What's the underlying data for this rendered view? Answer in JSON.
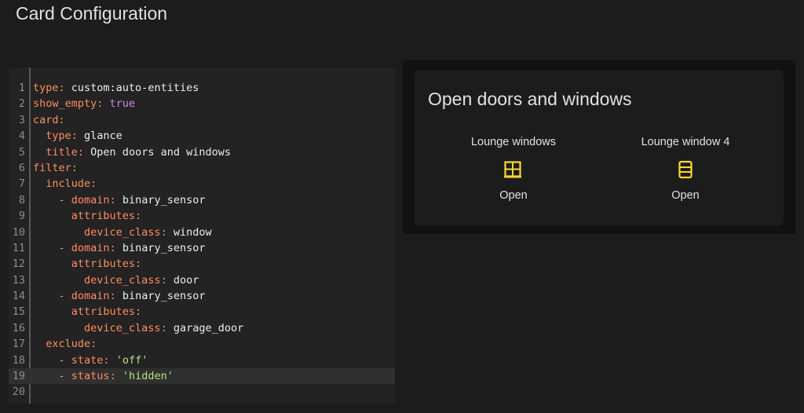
{
  "page": {
    "title": "Card Configuration"
  },
  "editor": {
    "lines": [
      {
        "n": "1",
        "indent": "",
        "key": "type",
        "sep": ": ",
        "val": "custom:auto-entities",
        "vt": "v",
        "dash": ""
      },
      {
        "n": "2",
        "indent": "",
        "key": "show_empty",
        "sep": ": ",
        "val": "true",
        "vt": "b",
        "dash": ""
      },
      {
        "n": "3",
        "indent": "",
        "key": "card",
        "sep": ":",
        "val": "",
        "vt": "v",
        "dash": ""
      },
      {
        "n": "4",
        "indent": "  ",
        "key": "type",
        "sep": ": ",
        "val": "glance",
        "vt": "v",
        "dash": ""
      },
      {
        "n": "5",
        "indent": "  ",
        "key": "title",
        "sep": ": ",
        "val": "Open doors and windows",
        "vt": "v",
        "dash": ""
      },
      {
        "n": "6",
        "indent": "",
        "key": "filter",
        "sep": ":",
        "val": "",
        "vt": "v",
        "dash": ""
      },
      {
        "n": "7",
        "indent": "  ",
        "key": "include",
        "sep": ":",
        "val": "",
        "vt": "v",
        "dash": ""
      },
      {
        "n": "8",
        "indent": "    ",
        "key": "domain",
        "sep": ": ",
        "val": "binary_sensor",
        "vt": "v",
        "dash": "- "
      },
      {
        "n": "9",
        "indent": "      ",
        "key": "attributes",
        "sep": ":",
        "val": "",
        "vt": "v",
        "dash": ""
      },
      {
        "n": "10",
        "indent": "        ",
        "key": "device_class",
        "sep": ": ",
        "val": "window",
        "vt": "v",
        "dash": ""
      },
      {
        "n": "11",
        "indent": "    ",
        "key": "domain",
        "sep": ": ",
        "val": "binary_sensor",
        "vt": "v",
        "dash": "- "
      },
      {
        "n": "12",
        "indent": "      ",
        "key": "attributes",
        "sep": ":",
        "val": "",
        "vt": "v",
        "dash": ""
      },
      {
        "n": "13",
        "indent": "        ",
        "key": "device_class",
        "sep": ": ",
        "val": "door",
        "vt": "v",
        "dash": ""
      },
      {
        "n": "14",
        "indent": "    ",
        "key": "domain",
        "sep": ": ",
        "val": "binary_sensor",
        "vt": "v",
        "dash": "- "
      },
      {
        "n": "15",
        "indent": "      ",
        "key": "attributes",
        "sep": ":",
        "val": "",
        "vt": "v",
        "dash": ""
      },
      {
        "n": "16",
        "indent": "        ",
        "key": "device_class",
        "sep": ": ",
        "val": "garage_door",
        "vt": "v",
        "dash": ""
      },
      {
        "n": "17",
        "indent": "  ",
        "key": "exclude",
        "sep": ":",
        "val": "",
        "vt": "v",
        "dash": ""
      },
      {
        "n": "18",
        "indent": "    ",
        "key": "state",
        "sep": ": ",
        "val": "'off'",
        "vt": "s",
        "dash": "- "
      },
      {
        "n": "19",
        "indent": "    ",
        "key": "status",
        "sep": ": ",
        "val": "'hidden'",
        "vt": "s",
        "dash": "- ",
        "active": true
      },
      {
        "n": "20",
        "indent": "",
        "key": "",
        "sep": "",
        "val": "",
        "vt": "v",
        "dash": ""
      }
    ]
  },
  "preview": {
    "card_title": "Open doors and windows",
    "entities": [
      {
        "name": "Lounge windows",
        "icon": "window-open-icon",
        "state": "Open"
      },
      {
        "name": "Lounge window 4",
        "icon": "window-open-variant-icon",
        "state": "Open"
      }
    ],
    "icon_color": "#fdd835"
  }
}
